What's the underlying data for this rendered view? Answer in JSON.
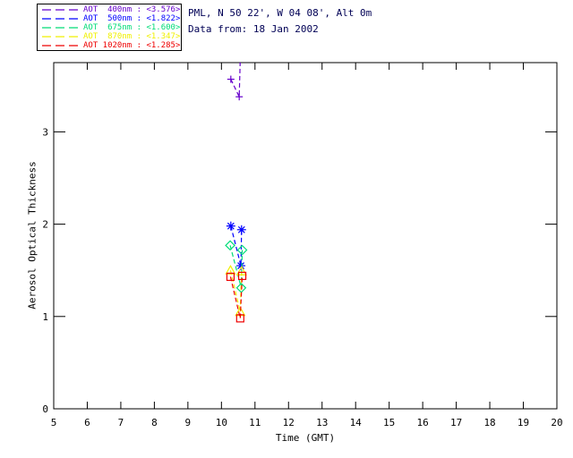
{
  "header": {
    "location": "PML, N 50 22', W 04 08', Alt 0m",
    "date": "Data from: 18 Jan 2002",
    "color": "#000055"
  },
  "legend": {
    "entries": [
      {
        "label": "AOT  400nm : <3.576>",
        "color": "#6600CC"
      },
      {
        "label": "AOT  500nm : <1.822>",
        "color": "#0000FF"
      },
      {
        "label": "AOT  675nm : <1.600>",
        "color": "#00DC78"
      },
      {
        "label": "AOT  870nm : <1.347>",
        "color": "#F0F000"
      },
      {
        "label": "AOT 1020nm : <1.285>",
        "color": "#EE0000"
      }
    ]
  },
  "chart_data": {
    "type": "line",
    "title": "",
    "xlabel": "Time (GMT)",
    "ylabel": "Aerosol Optical Thickness",
    "xlim": [
      5,
      20
    ],
    "ylim": [
      0,
      3.75
    ],
    "x_tick_values": [
      5,
      6,
      7,
      8,
      9,
      10,
      11,
      12,
      13,
      14,
      15,
      16,
      17,
      18,
      19,
      20
    ],
    "x_tick_labels": [
      "5",
      "6",
      "7",
      "8",
      "9",
      "10",
      "11",
      "12",
      "13",
      "14",
      "15",
      "16",
      "17",
      "18",
      "19",
      "20"
    ],
    "y_tick_values": [
      0,
      1,
      2,
      3
    ],
    "y_tick_labels": [
      "0",
      "1",
      "2",
      "3"
    ],
    "grid": false,
    "legend_position": "top-left-outside",
    "axis_color": "#000000",
    "series": [
      {
        "name": "AOT 400nm",
        "wavelength_nm": 400,
        "mean": 3.576,
        "color": "#6600CC",
        "marker": "plus",
        "linestyle": "dashed",
        "x": [
          10.28,
          10.53,
          10.56
        ],
        "y": [
          3.57,
          3.38,
          3.78
        ]
      },
      {
        "name": "AOT 500nm",
        "wavelength_nm": 500,
        "mean": 1.822,
        "color": "#0000FF",
        "marker": "asterisk",
        "linestyle": "dashed",
        "x": [
          10.28,
          10.58,
          10.6
        ],
        "y": [
          1.98,
          1.55,
          1.94
        ]
      },
      {
        "name": "AOT 675nm",
        "wavelength_nm": 675,
        "mean": 1.6,
        "color": "#00DC78",
        "marker": "diamond",
        "linestyle": "dashed",
        "x": [
          10.26,
          10.59,
          10.62
        ],
        "y": [
          1.77,
          1.31,
          1.72
        ]
      },
      {
        "name": "AOT 870nm",
        "wavelength_nm": 870,
        "mean": 1.347,
        "color": "#F0F000",
        "marker": "triangle",
        "linestyle": "dashed",
        "x": [
          10.27,
          10.56,
          10.6
        ],
        "y": [
          1.5,
          1.05,
          1.49
        ]
      },
      {
        "name": "AOT 1020nm",
        "wavelength_nm": 1020,
        "mean": 1.285,
        "color": "#EE0000",
        "marker": "square",
        "linestyle": "dashed",
        "x": [
          10.27,
          10.56,
          10.62
        ],
        "y": [
          1.43,
          0.98,
          1.44
        ]
      }
    ]
  }
}
